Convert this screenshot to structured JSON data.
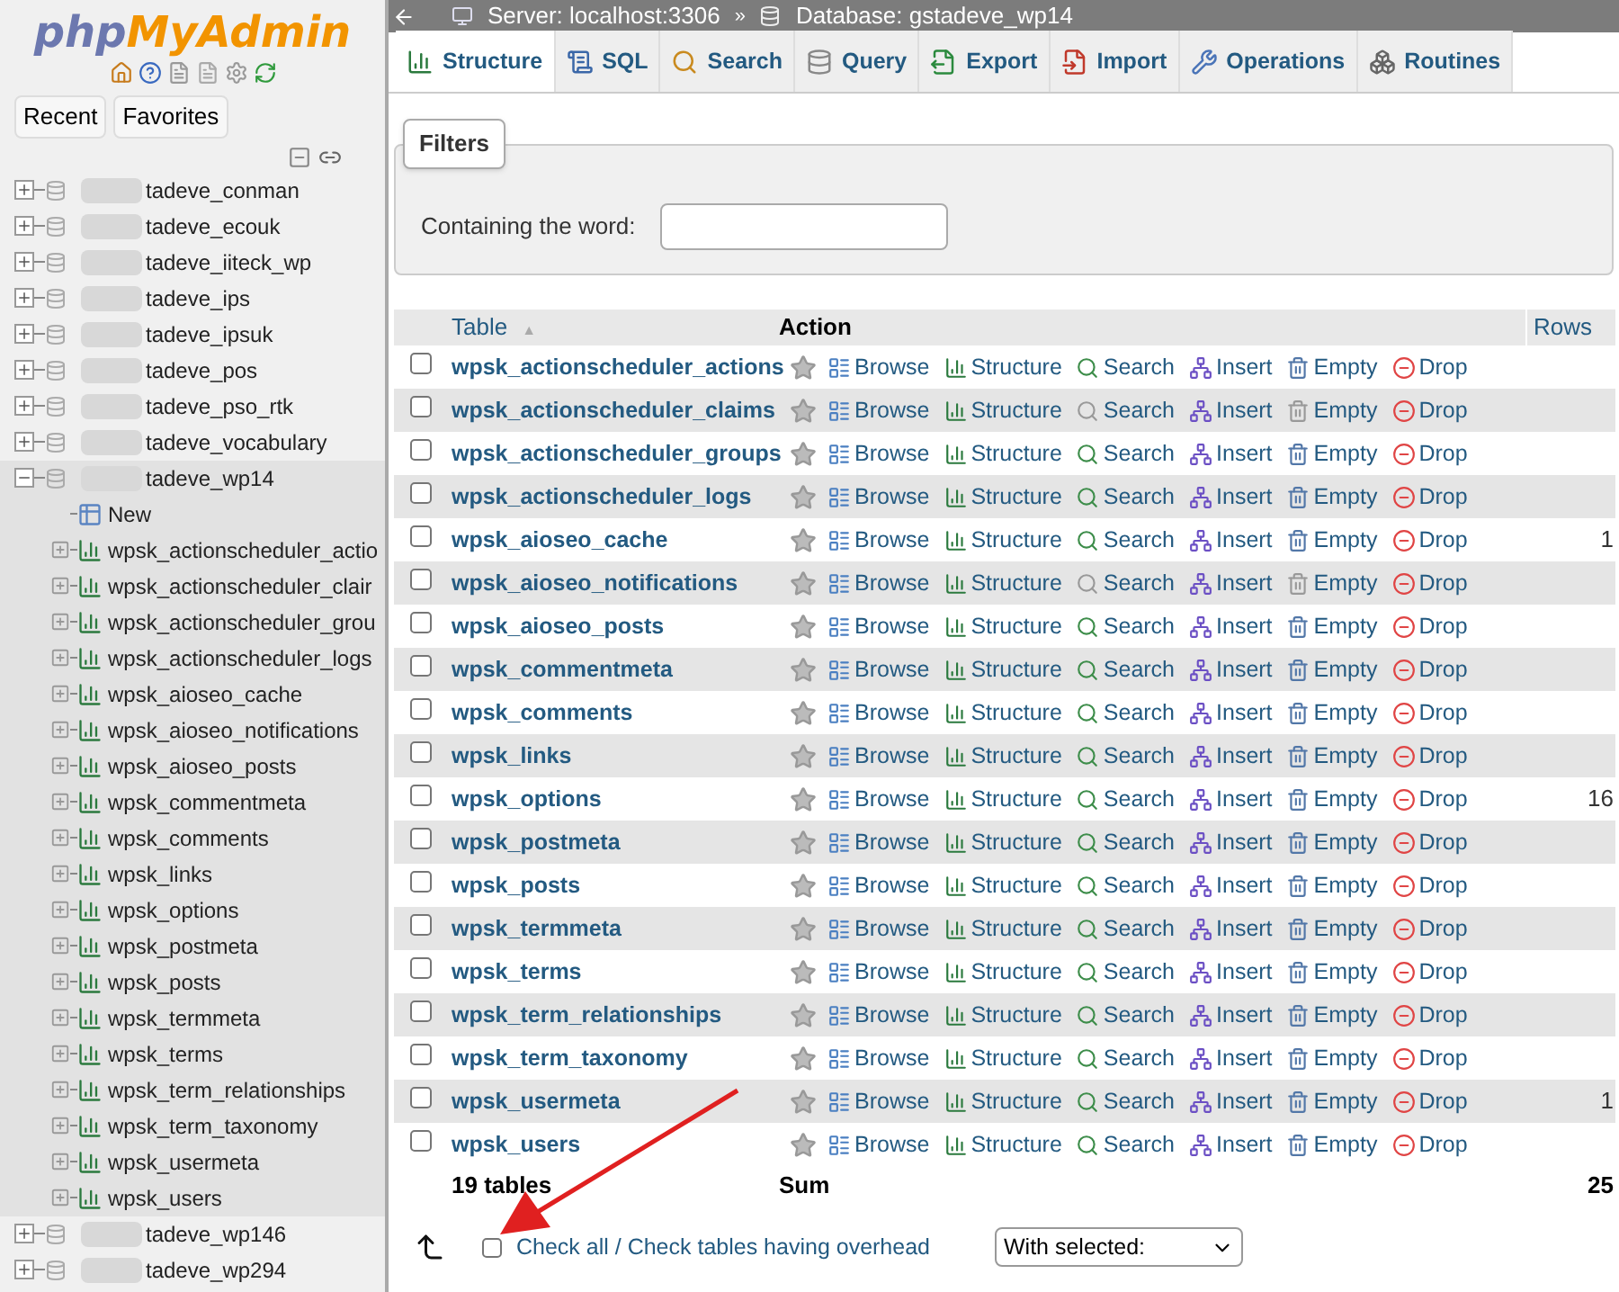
{
  "sidebar": {
    "logo": {
      "part_1": "php",
      "part_2": "MyAdmin"
    },
    "tabs": [
      {
        "label": "Recent",
        "selected": false
      },
      {
        "label": "Favorites",
        "selected": false
      }
    ],
    "databases": [
      {
        "name": "tadeve_conman",
        "expanded": false
      },
      {
        "name": "tadeve_ecouk",
        "expanded": false
      },
      {
        "name": "tadeve_iiteck_wp",
        "expanded": false
      },
      {
        "name": "tadeve_ips",
        "expanded": false
      },
      {
        "name": "tadeve_ipsuk",
        "expanded": false
      },
      {
        "name": "tadeve_pos",
        "expanded": false
      },
      {
        "name": "tadeve_pso_rtk",
        "expanded": false
      },
      {
        "name": "tadeve_vocabulary",
        "expanded": false
      },
      {
        "name": "tadeve_wp14",
        "expanded": true,
        "children": [
          {
            "name": "New",
            "kind": "new"
          },
          {
            "name": "wpsk_actionscheduler_actio",
            "kind": "table"
          },
          {
            "name": "wpsk_actionscheduler_clair",
            "kind": "table"
          },
          {
            "name": "wpsk_actionscheduler_grou",
            "kind": "table"
          },
          {
            "name": "wpsk_actionscheduler_logs",
            "kind": "table"
          },
          {
            "name": "wpsk_aioseo_cache",
            "kind": "table"
          },
          {
            "name": "wpsk_aioseo_notifications",
            "kind": "table"
          },
          {
            "name": "wpsk_aioseo_posts",
            "kind": "table"
          },
          {
            "name": "wpsk_commentmeta",
            "kind": "table"
          },
          {
            "name": "wpsk_comments",
            "kind": "table"
          },
          {
            "name": "wpsk_links",
            "kind": "table"
          },
          {
            "name": "wpsk_options",
            "kind": "table"
          },
          {
            "name": "wpsk_postmeta",
            "kind": "table"
          },
          {
            "name": "wpsk_posts",
            "kind": "table"
          },
          {
            "name": "wpsk_termmeta",
            "kind": "table"
          },
          {
            "name": "wpsk_terms",
            "kind": "table"
          },
          {
            "name": "wpsk_term_relationships",
            "kind": "table"
          },
          {
            "name": "wpsk_term_taxonomy",
            "kind": "table"
          },
          {
            "name": "wpsk_usermeta",
            "kind": "table"
          },
          {
            "name": "wpsk_users",
            "kind": "table"
          }
        ]
      },
      {
        "name": "tadeve_wp146",
        "expanded": false
      },
      {
        "name": "tadeve_wp294",
        "expanded": false
      }
    ]
  },
  "breadcrumb": {
    "server": "Server: localhost:3306",
    "separator": "»",
    "database": "Database: gstadeve_wp14"
  },
  "tabs": [
    {
      "label": "Structure",
      "kind": "structure",
      "selected": true
    },
    {
      "label": "SQL",
      "kind": "sql",
      "selected": false
    },
    {
      "label": "Search",
      "kind": "search",
      "selected": false
    },
    {
      "label": "Query",
      "kind": "query",
      "selected": false
    },
    {
      "label": "Export",
      "kind": "export",
      "selected": false
    },
    {
      "label": "Import",
      "kind": "import",
      "selected": false
    },
    {
      "label": "Operations",
      "kind": "operations",
      "selected": false
    },
    {
      "label": "Routines",
      "kind": "routines",
      "selected": false
    }
  ],
  "filters": {
    "legend": "Filters",
    "label": "Containing the word:"
  },
  "table": {
    "columns": [
      "Table",
      "Action",
      "Rows"
    ],
    "sort_indicator": "▲",
    "rows": [
      {
        "name": "wpsk_actionscheduler_actions",
        "checked": false,
        "empty": false,
        "actions": [
          "Browse",
          "Structure",
          "Search",
          "Insert",
          "Empty",
          "Drop"
        ]
      },
      {
        "name": "wpsk_actionscheduler_claims",
        "checked": false,
        "empty": true,
        "actions": [
          "Browse",
          "Structure",
          "Search",
          "Insert",
          "Empty",
          "Drop"
        ]
      },
      {
        "name": "wpsk_actionscheduler_groups",
        "checked": false,
        "empty": false,
        "actions": [
          "Browse",
          "Structure",
          "Search",
          "Insert",
          "Empty",
          "Drop"
        ]
      },
      {
        "name": "wpsk_actionscheduler_logs",
        "checked": false,
        "empty": false,
        "actions": [
          "Browse",
          "Structure",
          "Search",
          "Insert",
          "Empty",
          "Drop"
        ]
      },
      {
        "name": "wpsk_aioseo_cache",
        "checked": false,
        "empty": false,
        "actions": [
          "Browse",
          "Structure",
          "Search",
          "Insert",
          "Empty",
          "Drop"
        ],
        "rows": "1"
      },
      {
        "name": "wpsk_aioseo_notifications",
        "checked": false,
        "empty": true,
        "actions": [
          "Browse",
          "Structure",
          "Search",
          "Insert",
          "Empty",
          "Drop"
        ]
      },
      {
        "name": "wpsk_aioseo_posts",
        "checked": false,
        "empty": false,
        "actions": [
          "Browse",
          "Structure",
          "Search",
          "Insert",
          "Empty",
          "Drop"
        ]
      },
      {
        "name": "wpsk_commentmeta",
        "checked": false,
        "empty": false,
        "actions": [
          "Browse",
          "Structure",
          "Search",
          "Insert",
          "Empty",
          "Drop"
        ]
      },
      {
        "name": "wpsk_comments",
        "checked": false,
        "empty": false,
        "actions": [
          "Browse",
          "Structure",
          "Search",
          "Insert",
          "Empty",
          "Drop"
        ]
      },
      {
        "name": "wpsk_links",
        "checked": false,
        "empty": false,
        "actions": [
          "Browse",
          "Structure",
          "Search",
          "Insert",
          "Empty",
          "Drop"
        ]
      },
      {
        "name": "wpsk_options",
        "checked": false,
        "empty": false,
        "actions": [
          "Browse",
          "Structure",
          "Search",
          "Insert",
          "Empty",
          "Drop"
        ],
        "rows": "16"
      },
      {
        "name": "wpsk_postmeta",
        "checked": false,
        "empty": false,
        "actions": [
          "Browse",
          "Structure",
          "Search",
          "Insert",
          "Empty",
          "Drop"
        ]
      },
      {
        "name": "wpsk_posts",
        "checked": false,
        "empty": false,
        "actions": [
          "Browse",
          "Structure",
          "Search",
          "Insert",
          "Empty",
          "Drop"
        ]
      },
      {
        "name": "wpsk_termmeta",
        "checked": false,
        "empty": false,
        "actions": [
          "Browse",
          "Structure",
          "Search",
          "Insert",
          "Empty",
          "Drop"
        ]
      },
      {
        "name": "wpsk_terms",
        "checked": false,
        "empty": false,
        "actions": [
          "Browse",
          "Structure",
          "Search",
          "Insert",
          "Empty",
          "Drop"
        ]
      },
      {
        "name": "wpsk_term_relationships",
        "checked": false,
        "empty": false,
        "actions": [
          "Browse",
          "Structure",
          "Search",
          "Insert",
          "Empty",
          "Drop"
        ]
      },
      {
        "name": "wpsk_term_taxonomy",
        "checked": false,
        "empty": false,
        "actions": [
          "Browse",
          "Structure",
          "Search",
          "Insert",
          "Empty",
          "Drop"
        ]
      },
      {
        "name": "wpsk_usermeta",
        "checked": false,
        "empty": false,
        "actions": [
          "Browse",
          "Structure",
          "Search",
          "Insert",
          "Empty",
          "Drop"
        ],
        "rows": "1"
      },
      {
        "name": "wpsk_users",
        "checked": false,
        "empty": false,
        "actions": [
          "Browse",
          "Structure",
          "Search",
          "Insert",
          "Empty",
          "Drop"
        ]
      }
    ],
    "footer": {
      "count": "19 tables",
      "sum_label": "Sum",
      "rows": "25"
    }
  },
  "bulk": {
    "check_all_checked": false,
    "check_all": "Check all / Check tables having overhead",
    "with_selected": "With selected:"
  }
}
